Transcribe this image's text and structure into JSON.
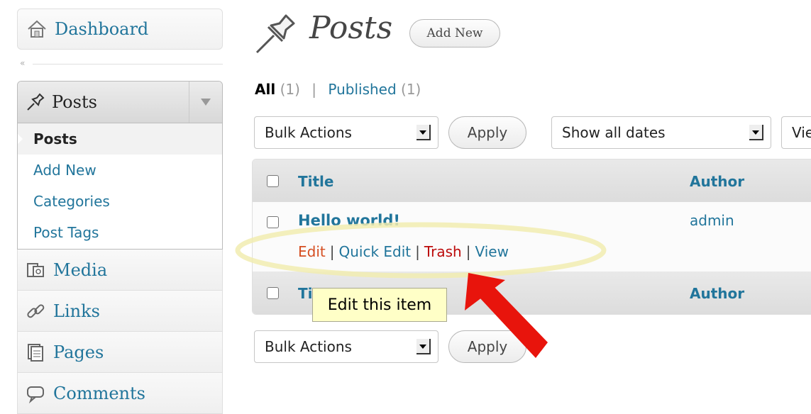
{
  "sidebar": {
    "dashboard": "Dashboard",
    "posts_menu": {
      "label": "Posts",
      "items": [
        {
          "label": "Posts",
          "current": true
        },
        {
          "label": "Add New"
        },
        {
          "label": "Categories"
        },
        {
          "label": "Post Tags"
        }
      ]
    },
    "media": "Media",
    "links": "Links",
    "pages": "Pages",
    "comments": "Comments"
  },
  "header": {
    "title": "Posts",
    "add_new": "Add New"
  },
  "filters": {
    "all_label": "All",
    "all_count": "(1)",
    "separator": "|",
    "published_label": "Published",
    "published_count": "(1)"
  },
  "toolbar": {
    "bulk_actions": "Bulk Actions",
    "apply": "Apply",
    "dates": "Show all dates",
    "view_partial": "Vie"
  },
  "table": {
    "columns": [
      "Title",
      "Author"
    ],
    "footer_title_partial": "Ti",
    "rows": [
      {
        "title": "Hello world!",
        "author": "admin",
        "actions": [
          "Edit",
          "Quick Edit",
          "Trash",
          "View"
        ]
      }
    ]
  },
  "tooltip": "Edit this item",
  "colors": {
    "link": "#21759b",
    "edit_action": "#d54e21",
    "trash_action": "#bc0b0b",
    "highlight": "#f1ecb0",
    "arrow": "#e8140c",
    "tooltip_bg": "#ffffc7"
  }
}
